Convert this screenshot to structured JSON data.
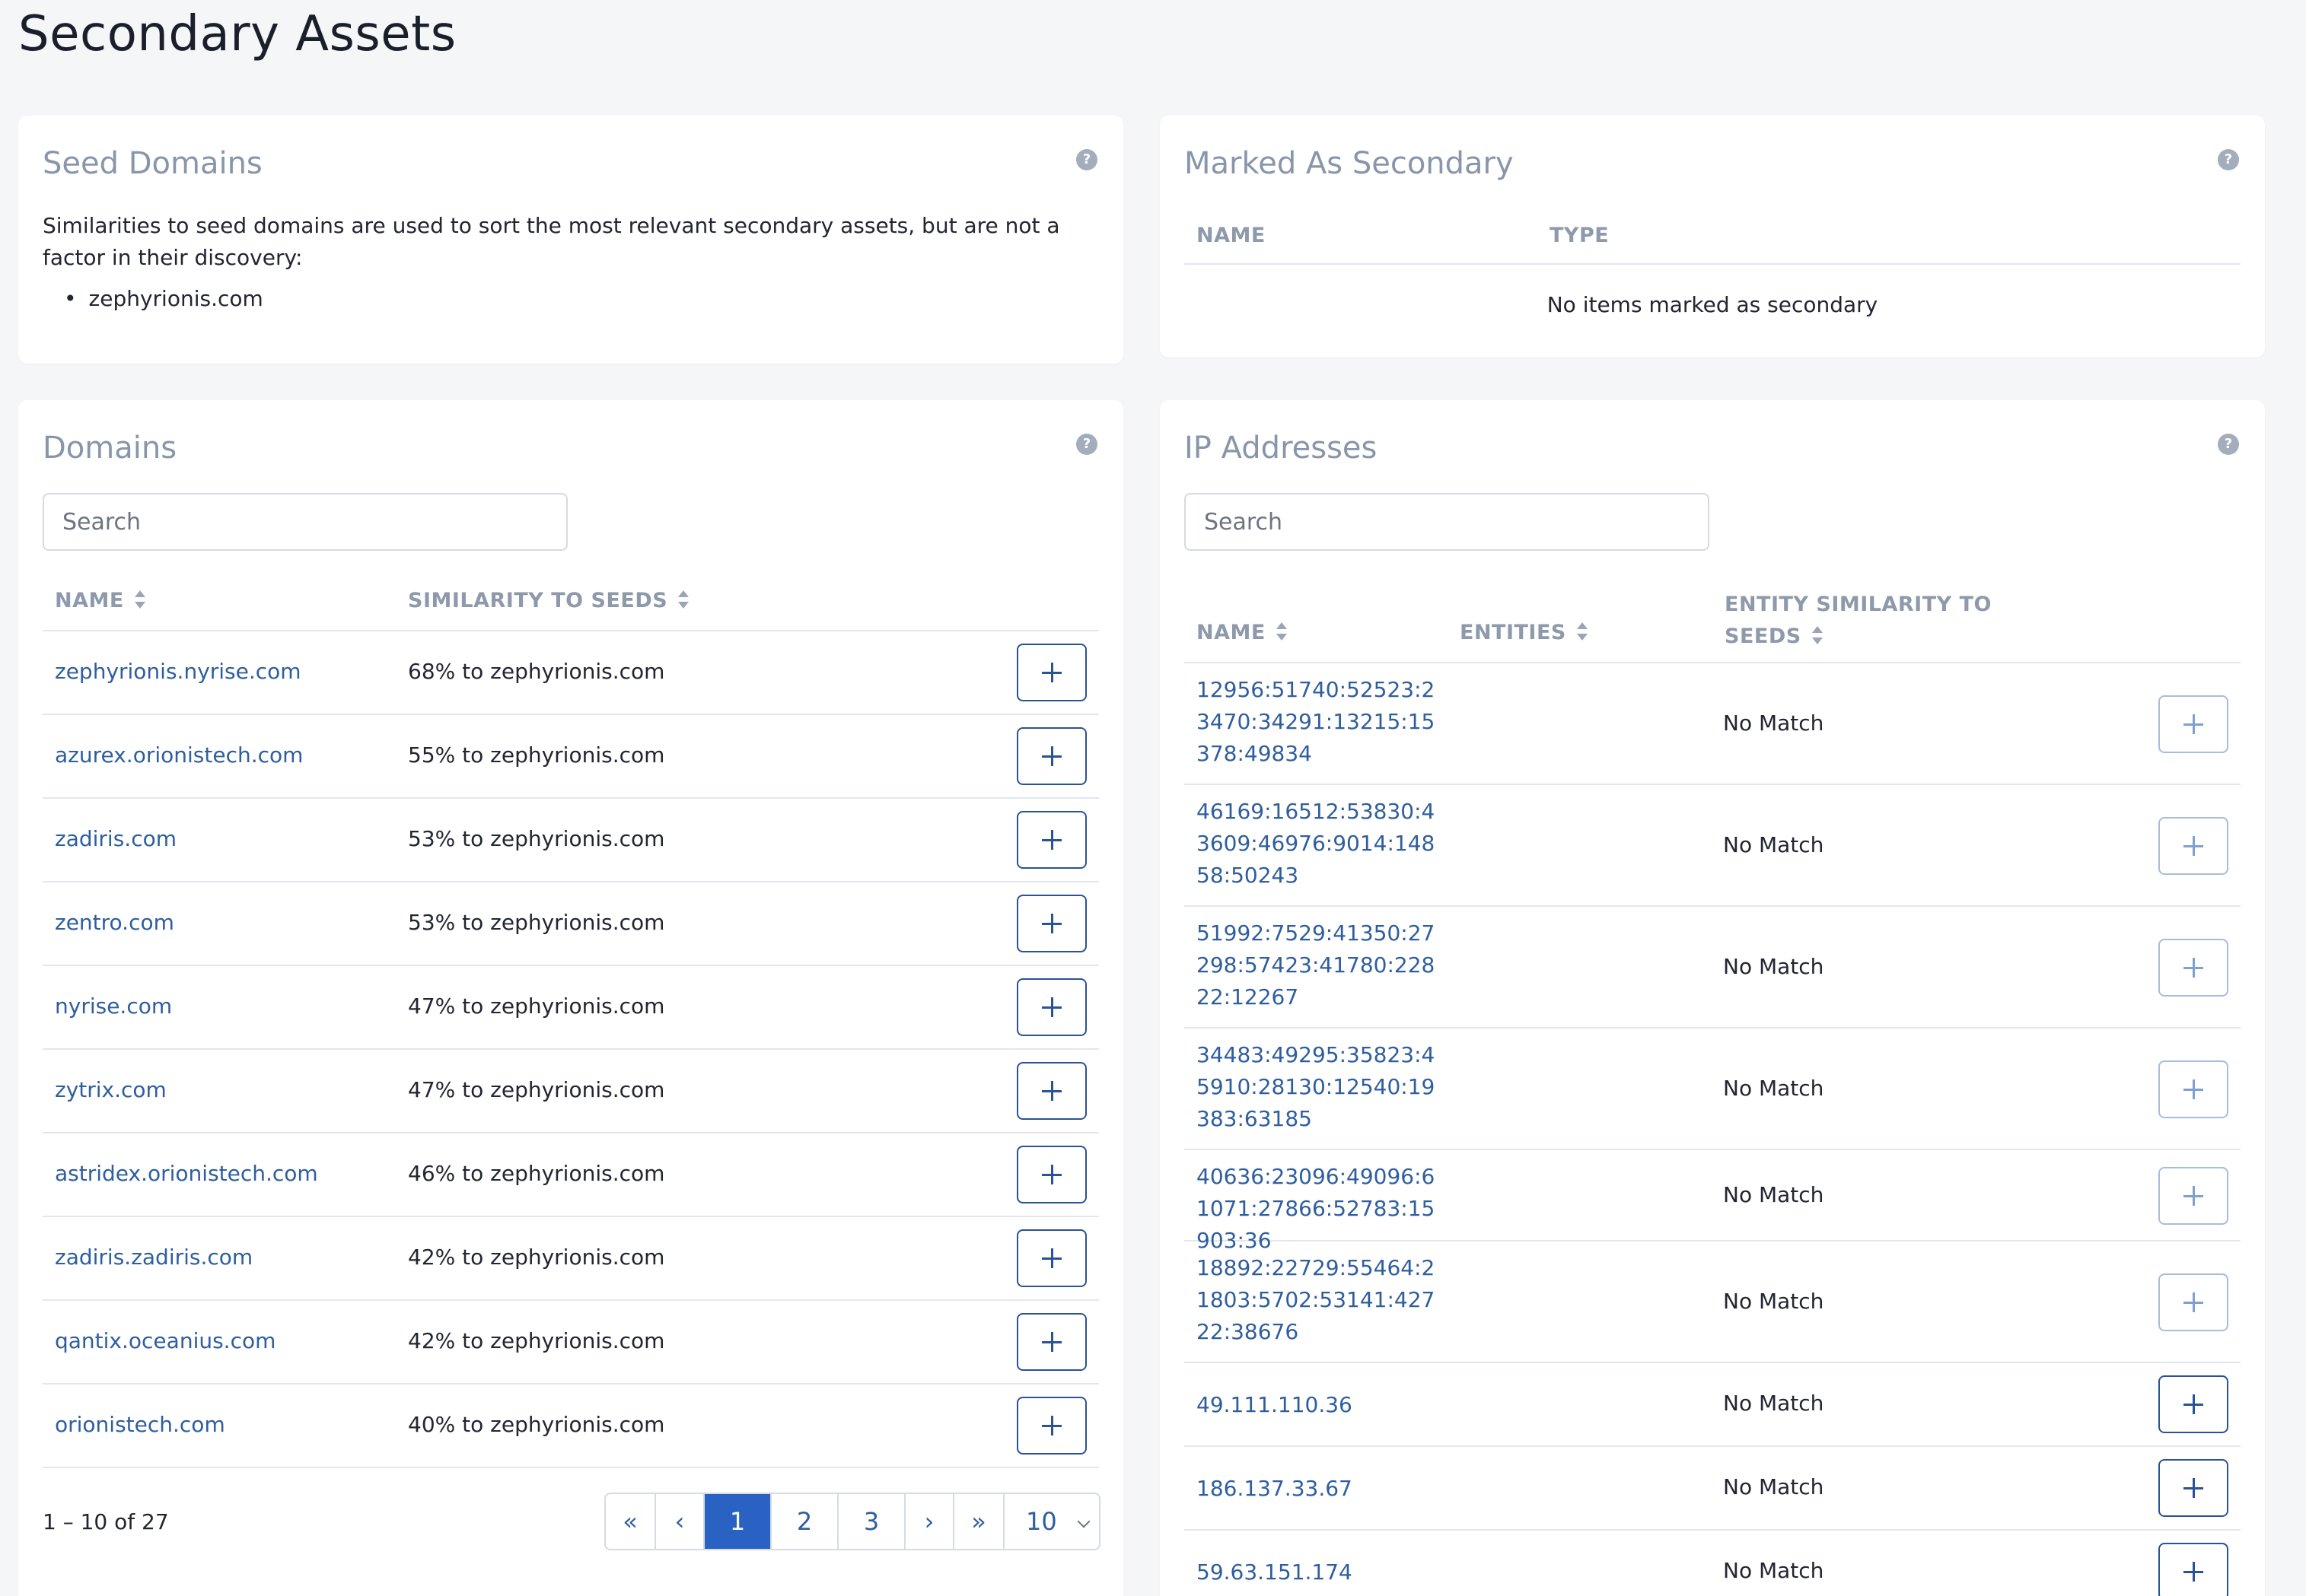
{
  "page": {
    "title": "Secondary Assets"
  },
  "seed_card": {
    "title": "Seed Domains",
    "description": "Similarities to seed domains are used to sort the most relevant secondary assets, but are not a factor in their discovery:",
    "seeds": [
      "zephyrionis.com"
    ]
  },
  "secondary_card": {
    "title": "Marked As Secondary",
    "columns": [
      "NAME",
      "TYPE"
    ],
    "empty_message": "No items marked as secondary"
  },
  "domains_card": {
    "title": "Domains",
    "search_placeholder": "Search",
    "columns": [
      "NAME",
      "SIMILARITY TO SEEDS"
    ],
    "rows": [
      {
        "name": "zephyrionis.nyrise.com",
        "similarity": "68% to zephyrionis.com"
      },
      {
        "name": "azurex.orionistech.com",
        "similarity": "55% to zephyrionis.com"
      },
      {
        "name": "zadiris.com",
        "similarity": "53% to zephyrionis.com"
      },
      {
        "name": "zentro.com",
        "similarity": "53% to zephyrionis.com"
      },
      {
        "name": "nyrise.com",
        "similarity": "47% to zephyrionis.com"
      },
      {
        "name": "zytrix.com",
        "similarity": "47% to zephyrionis.com"
      },
      {
        "name": "astridex.orionistech.com",
        "similarity": "46% to zephyrionis.com"
      },
      {
        "name": "zadiris.zadiris.com",
        "similarity": "42% to zephyrionis.com"
      },
      {
        "name": "qantix.oceanius.com",
        "similarity": "42% to zephyrionis.com"
      },
      {
        "name": "orionistech.com",
        "similarity": "40% to zephyrionis.com"
      }
    ],
    "pagination": {
      "info": "1 – 10 of 27",
      "first": "«",
      "prev": "‹",
      "pages": [
        "1",
        "2",
        "3"
      ],
      "next": "›",
      "last": "»",
      "per_page": "10"
    }
  },
  "ip_card": {
    "title": "IP Addresses",
    "search_placeholder": "Search",
    "columns": [
      "NAME",
      "ENTITIES",
      "ENTITY SIMILARITY TO SEEDS"
    ],
    "rows": [
      {
        "name": "12956:51740:52523:23470:34291:13215:15378:49834",
        "entity_similarity": "No Match"
      },
      {
        "name": "46169:16512:53830:43609:46976:9014:14858:50243",
        "entity_similarity": "No Match"
      },
      {
        "name": "51992:7529:41350:27298:57423:41780:22822:12267",
        "entity_similarity": "No Match"
      },
      {
        "name": "34483:49295:35823:45910:28130:12540:19383:63185",
        "entity_similarity": "No Match"
      },
      {
        "name": "40636:23096:49096:61071:27866:52783:15903:36",
        "entity_similarity": "No Match"
      },
      {
        "name": "18892:22729:55464:21803:5702:53141:42722:38676",
        "entity_similarity": "No Match"
      },
      {
        "name": "49.111.110.36",
        "entity_similarity": "No Match"
      },
      {
        "name": "186.137.33.67",
        "entity_similarity": "No Match"
      },
      {
        "name": "59.63.151.174",
        "entity_similarity": "No Match"
      }
    ]
  },
  "colors": {
    "link": "#2f5e9e",
    "accent": "#2a62c4",
    "muted_heading": "#8896aa"
  }
}
